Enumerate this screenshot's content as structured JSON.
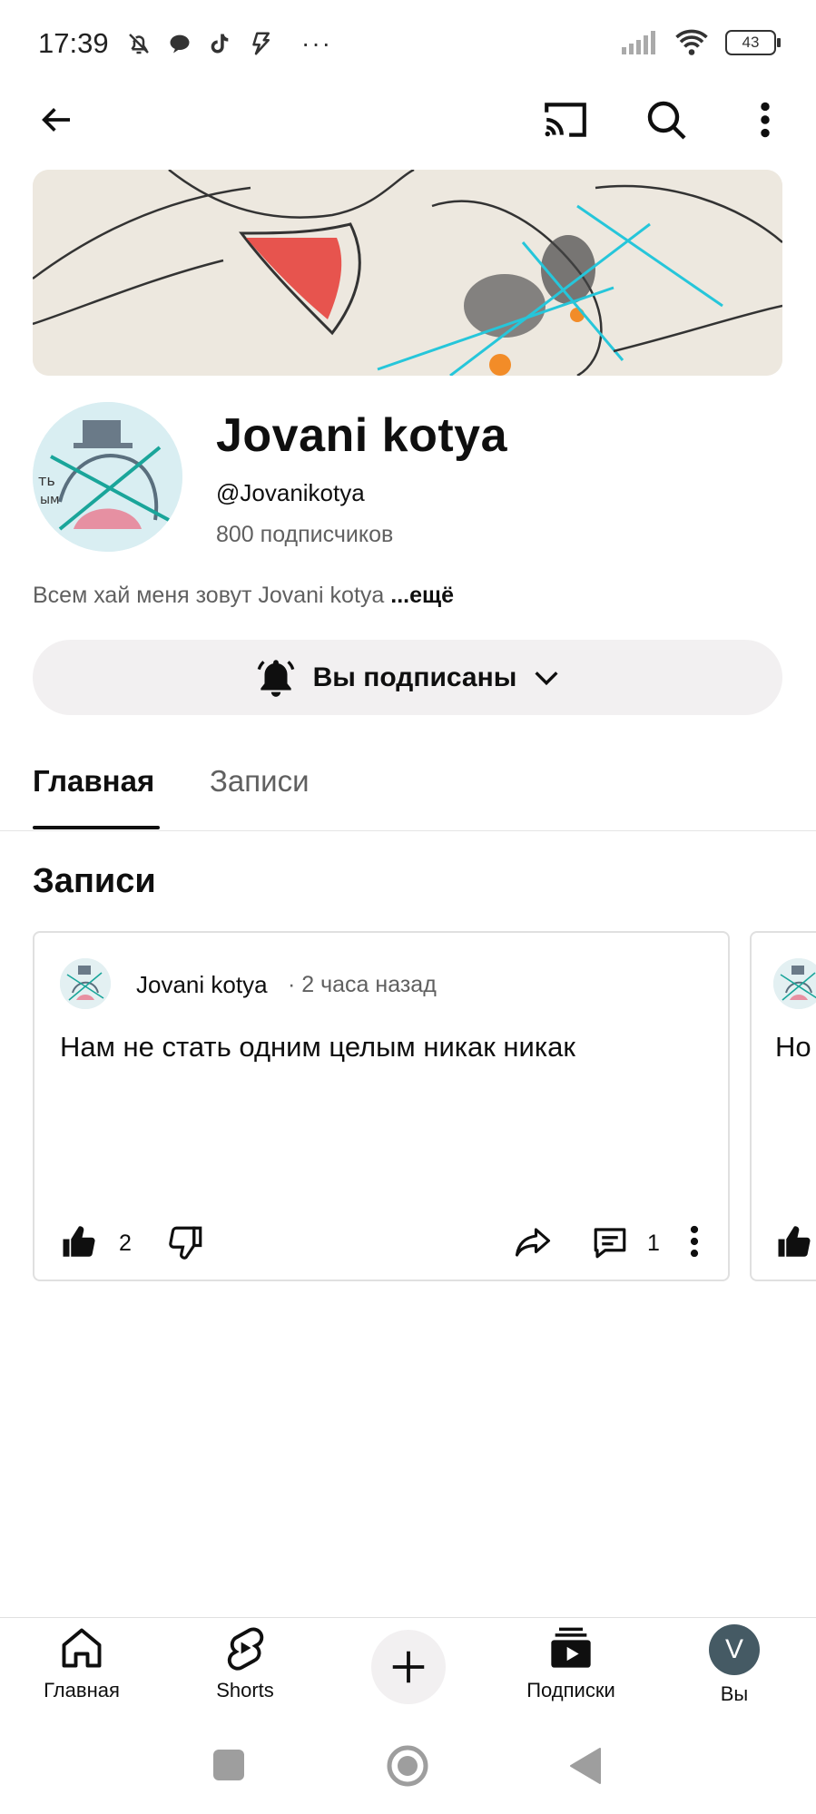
{
  "status_bar": {
    "time": "17:39",
    "more": "···",
    "battery": "43"
  },
  "channel": {
    "name": "Jovani kotya",
    "handle": "@Jovanikotya",
    "subscribers": "800 подписчиков",
    "description": "Всем хай меня зовут Jovani kotya",
    "description_more": "...ещё",
    "subscribe_label": "Вы подписаны"
  },
  "tabs": [
    {
      "label": "Главная",
      "active": true
    },
    {
      "label": "Записи",
      "active": false
    }
  ],
  "section_title": "Записи",
  "posts": [
    {
      "author": "Jovani kotya",
      "time": "· 2 часа назад",
      "text": "Нам не стать одним целым никак никак",
      "likes": "2",
      "comments": "1"
    },
    {
      "text_partial": "Но"
    }
  ],
  "bottom_nav": [
    {
      "label": "Главная",
      "icon": "home-icon"
    },
    {
      "label": "Shorts",
      "icon": "shorts-icon"
    },
    {
      "label": "",
      "icon": "plus-icon"
    },
    {
      "label": "Подписки",
      "icon": "subscriptions-icon"
    },
    {
      "label": "Вы",
      "icon": "avatar",
      "initial": "V"
    }
  ]
}
